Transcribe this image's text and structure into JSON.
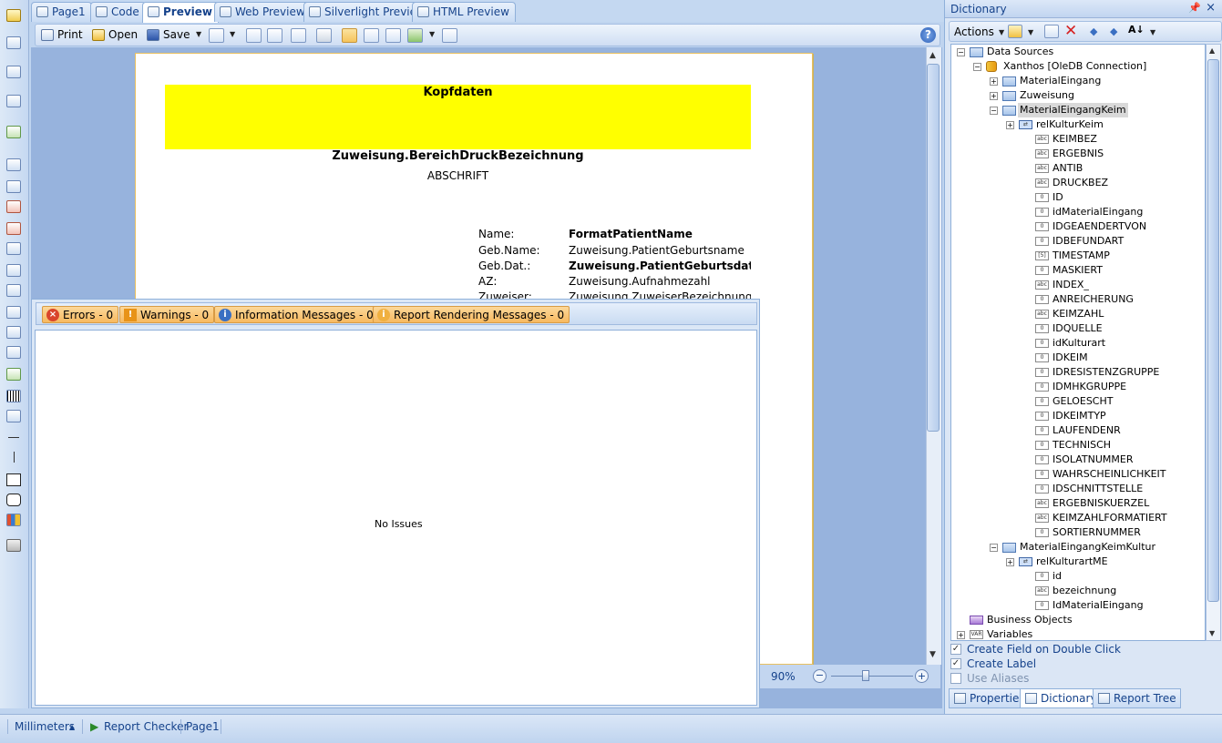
{
  "tabs": [
    {
      "label": "Page1",
      "icon": "page-icon"
    },
    {
      "label": "Code",
      "icon": "code-icon"
    },
    {
      "label": "Preview",
      "icon": "magnifier-icon",
      "active": true
    },
    {
      "label": "Web Preview",
      "icon": "web-preview-icon"
    },
    {
      "label": "Silverlight Preview",
      "icon": "silverlight-icon"
    },
    {
      "label": "HTML Preview",
      "icon": "html-preview-icon"
    }
  ],
  "preview_toolbar": {
    "print": "Print",
    "open": "Open",
    "save": "Save",
    "help": "?"
  },
  "report": {
    "header": "Kopfdaten",
    "area_name": "Zuweisung.BereichDruckBezeichnung",
    "copy_label": "ABSCHRIFT",
    "fields": [
      {
        "label": "Name:",
        "value": "FormatPatientName",
        "bold": true
      },
      {
        "label": "Geb.Name:",
        "value": "Zuweisung.PatientGeburtsname",
        "bold": false
      },
      {
        "label": "Geb.Dat.:",
        "value": "Zuweisung.PatientGeburtsdatur",
        "bold": true
      },
      {
        "label": "AZ:",
        "value": "Zuweisung.Aufnahmezahl",
        "bold": false
      },
      {
        "label": "Zuweiser:",
        "value": "Zuweisung.ZuweiserBezeichnung",
        "bold": false
      }
    ]
  },
  "zoom": {
    "value": "90%"
  },
  "checker": {
    "tabs": [
      {
        "label": "Errors - 0",
        "icon": "error-icon",
        "color": "#d9452b"
      },
      {
        "label": "Warnings - 0",
        "icon": "warning-icon",
        "color": "#e89318"
      },
      {
        "label": "Information Messages - 0",
        "icon": "info-icon",
        "color": "#3a6fc2"
      },
      {
        "label": "Report Rendering Messages - 0",
        "icon": "rendering-message-icon",
        "color": "#f0b040"
      }
    ],
    "empty_text": "No Issues"
  },
  "dictionary": {
    "title": "Dictionary",
    "actions": "Actions",
    "tree": {
      "data_sources": "Data Sources",
      "connection": "Xanthos [OleDB Connection]",
      "tables": [
        "MaterialEingang",
        "Zuweisung"
      ],
      "selected_table": "MaterialEingangKeim",
      "relation": "relKulturKeim",
      "columns": [
        {
          "name": "KEIMBEZ",
          "type": "abc"
        },
        {
          "name": "ERGEBNIS",
          "type": "abc"
        },
        {
          "name": "ANTIB",
          "type": "abc"
        },
        {
          "name": "DRUCKBEZ",
          "type": "abc"
        },
        {
          "name": "ID",
          "type": "0"
        },
        {
          "name": "idMaterialEingang",
          "type": "0"
        },
        {
          "name": "IDGEAENDERTVON",
          "type": "0"
        },
        {
          "name": "IDBEFUNDART",
          "type": "0"
        },
        {
          "name": "TIMESTAMP",
          "type": "date"
        },
        {
          "name": "MASKIERT",
          "type": "0"
        },
        {
          "name": "INDEX_",
          "type": "abc"
        },
        {
          "name": "ANREICHERUNG",
          "type": "0"
        },
        {
          "name": "KEIMZAHL",
          "type": "abc"
        },
        {
          "name": "IDQUELLE",
          "type": "0"
        },
        {
          "name": "idKulturart",
          "type": "0"
        },
        {
          "name": "IDKEIM",
          "type": "0"
        },
        {
          "name": "IDRESISTENZGRUPPE",
          "type": "0"
        },
        {
          "name": "IDMHKGRUPPE",
          "type": "0"
        },
        {
          "name": "GELOESCHT",
          "type": "0"
        },
        {
          "name": "IDKEIMTYP",
          "type": "0"
        },
        {
          "name": "LAUFENDENR",
          "type": "0"
        },
        {
          "name": "TECHNISCH",
          "type": "0"
        },
        {
          "name": "ISOLATNUMMER",
          "type": "0"
        },
        {
          "name": "WAHRSCHEINLICHKEIT",
          "type": "0"
        },
        {
          "name": "IDSCHNITTSTELLE",
          "type": "0"
        },
        {
          "name": "ERGEBNISKUERZEL",
          "type": "abc"
        },
        {
          "name": "KEIMZAHLFORMATIERT",
          "type": "abc"
        },
        {
          "name": "SORTIERNUMMER",
          "type": "0"
        }
      ],
      "table2": "MaterialEingangKeimKultur",
      "relation2": "relKulturartME",
      "columns2": [
        {
          "name": "id",
          "type": "0"
        },
        {
          "name": "bezeichnung",
          "type": "abc"
        },
        {
          "name": "IdMaterialEingang",
          "type": "0"
        }
      ],
      "business_objects": "Business Objects",
      "variables": "Variables"
    },
    "options": [
      {
        "label": "Create Field on Double Click",
        "checked": true
      },
      {
        "label": "Create Label",
        "checked": true
      },
      {
        "label": "Use Aliases",
        "checked": false
      }
    ],
    "bottom_tabs": [
      "Properties",
      "Dictionary",
      "Report Tree"
    ]
  },
  "status": {
    "units": "Millimeters",
    "checker": "Report Checker",
    "page": "Page1"
  }
}
